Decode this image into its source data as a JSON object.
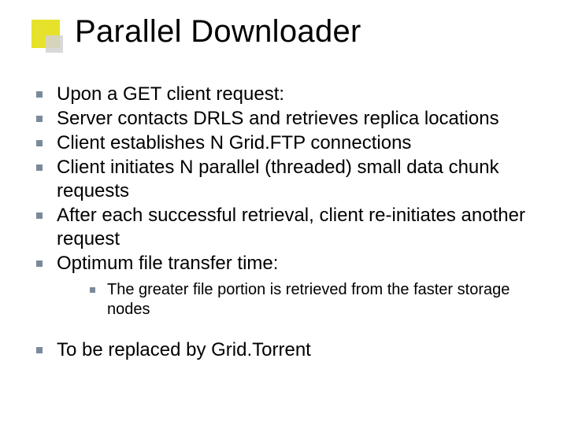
{
  "title": "Parallel Downloader",
  "bullets": [
    "Upon a GET client request:",
    "Server contacts DRLS and retrieves replica locations",
    "Client establishes N Grid.FTP connections",
    "Client initiates N parallel (threaded) small data chunk requests",
    "After each successful retrieval, client re-initiates another request",
    "Optimum file transfer time:"
  ],
  "subbullet": "The greater file portion is retrieved from the faster storage nodes",
  "final_bullet": "To be replaced by Grid.Torrent"
}
